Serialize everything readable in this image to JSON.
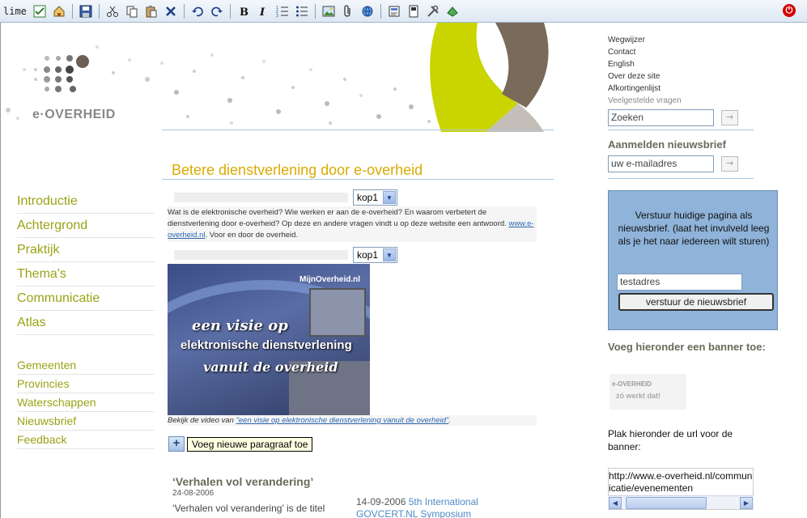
{
  "toolbar": {
    "brand": "lime",
    "power_label": "⏻",
    "accent": "#2b5ea7"
  },
  "header": {
    "logo_text": "e·OVERHEID"
  },
  "left_nav": {
    "main": [
      "Introductie",
      "Achtergrond",
      "Praktijk",
      "Thema's",
      "Communicatie",
      "Atlas"
    ],
    "sub": [
      "Gemeenten",
      "Provincies",
      "Waterschappen",
      "Nieuwsbrief",
      "Feedback"
    ],
    "color": "#99a316"
  },
  "main": {
    "title": "Betere dienstverlening door e-overheid",
    "kop1": "kop1",
    "kop2": "kop1",
    "intro_before": "Wat is de elektronische overheid? Wie werken er aan de e-overheid? En waarom verbetert de dienstverlening door e-overheid? Op deze en andere vragen vindt u op deze website een antwoord. ",
    "intro_link": "www.e-overheid.nl",
    "intro_after": ". Voor en door de overheid.",
    "video": {
      "logo": "MijnOverheid.nl",
      "line1": "een visie op",
      "line2": "elektronische dienstverlening",
      "line3": "vanuit de overheid"
    },
    "caption_before": "Bekijk de video van ",
    "caption_link": "\"een visie op elektronische dienstverlening vanuit de overheid\"",
    "caption_after": ".",
    "add_paragraph_tooltip": "Voeg nieuwe paragraaf toe",
    "story": {
      "title": "‘Verhalen vol verandering’",
      "date": "24-08-2006",
      "text": "‘Verhalen vol verandering’ is de titel"
    },
    "event": {
      "date": "14-09-2006",
      "title": "5th International GOVCERT.NL Symposium"
    }
  },
  "right": {
    "quicklinks": [
      "Wegwijzer",
      "Contact",
      "English",
      "Over deze site",
      "Afkortingenlijst",
      "Veelgestelde vragen"
    ],
    "search_placeholder": "Zoeken",
    "go_symbol": "⇾",
    "newsletter_heading": "Aanmelden nieuwsbrief",
    "email_placeholder": "uw e-mailadres",
    "send_panel": {
      "message": "Verstuur huidige pagina als nieuwsbrief. (laat het invulveld leeg als je het naar iedereen wilt sturen)",
      "test_value": "testadres",
      "button": "verstuur de nieuwsbrief",
      "color": "#8fb3d9"
    },
    "banner_heading": "Voeg hieronder een banner toe:",
    "banner": {
      "line1": "e-OVERHEID",
      "line2": "zó werkt dat!"
    },
    "url_label": "Plak hieronder de url voor de banner:",
    "url_value": "http://www.e-overheid.nl/communicatie/evenementen"
  }
}
